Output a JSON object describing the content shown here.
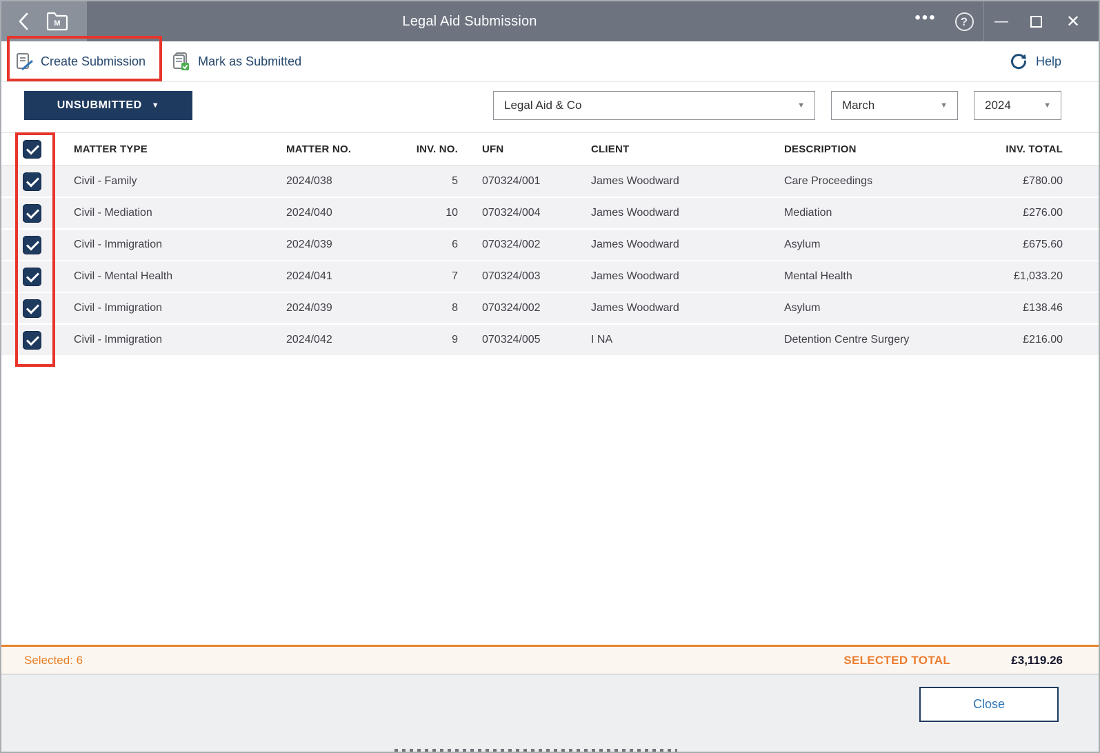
{
  "window": {
    "title": "Legal Aid Submission"
  },
  "icons": {
    "back": "back-chevron",
    "folder_label": "M",
    "more": "•••",
    "help_circle": "?",
    "minimize": "—",
    "maximize": "maximize-box",
    "close": "✕",
    "dropdown_arrow": "▼"
  },
  "toolbar": {
    "create_submission": "Create Submission",
    "mark_as_submitted": "Mark as Submitted",
    "help_label": "Help"
  },
  "filters": {
    "status": "UNSUBMITTED",
    "provider": "Legal Aid & Co",
    "month": "March",
    "year": "2024"
  },
  "table": {
    "header_checked": true,
    "columns": [
      "MATTER TYPE",
      "MATTER NO.",
      "INV. NO.",
      "UFN",
      "CLIENT",
      "DESCRIPTION",
      "INV. TOTAL"
    ],
    "rows": [
      {
        "checked": true,
        "matter_type": "Civil - Family",
        "matter_no": "2024/038",
        "inv_no": "5",
        "ufn": "070324/001",
        "client": "James Woodward",
        "description": "Care Proceedings",
        "inv_total": "£780.00"
      },
      {
        "checked": true,
        "matter_type": "Civil - Mediation",
        "matter_no": "2024/040",
        "inv_no": "10",
        "ufn": "070324/004",
        "client": "James Woodward",
        "description": "Mediation",
        "inv_total": "£276.00"
      },
      {
        "checked": true,
        "matter_type": "Civil - Immigration",
        "matter_no": "2024/039",
        "inv_no": "6",
        "ufn": "070324/002",
        "client": "James Woodward",
        "description": "Asylum",
        "inv_total": "£675.60"
      },
      {
        "checked": true,
        "matter_type": "Civil - Mental Health",
        "matter_no": "2024/041",
        "inv_no": "7",
        "ufn": "070324/003",
        "client": "James Woodward",
        "description": "Mental Health",
        "inv_total": "£1,033.20"
      },
      {
        "checked": true,
        "matter_type": "Civil - Immigration",
        "matter_no": "2024/039",
        "inv_no": "8",
        "ufn": "070324/002",
        "client": "James Woodward",
        "description": "Asylum",
        "inv_total": "£138.46"
      },
      {
        "checked": true,
        "matter_type": "Civil - Immigration",
        "matter_no": "2024/042",
        "inv_no": "9",
        "ufn": "070324/005",
        "client": "I NA",
        "description": "Detention Centre Surgery",
        "inv_total": "£216.00"
      }
    ]
  },
  "summary": {
    "selected_label": "Selected: 6",
    "total_label": "SELECTED TOTAL",
    "total_value": "£3,119.26"
  },
  "footer": {
    "close_label": "Close"
  },
  "colors": {
    "titlebar": "#6d7480",
    "titlebar_left": "#8b919b",
    "accent_navy": "#1e3a5f",
    "accent_orange": "#e87f27",
    "annotation_red": "#e8352b",
    "link_blue": "#1f4e79",
    "row_bg": "#f2f2f5",
    "summary_bg": "#fbf7f0",
    "footer_bg": "#edeff1"
  }
}
